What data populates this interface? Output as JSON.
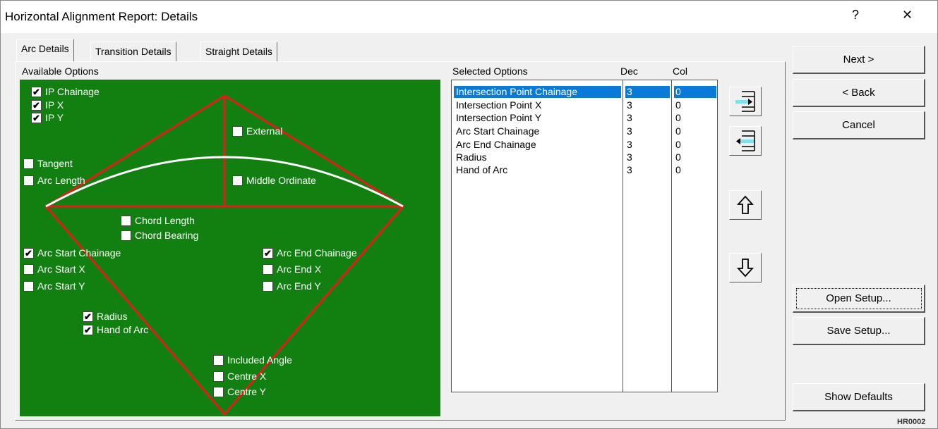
{
  "window": {
    "title": "Horizontal Alignment Report: Details",
    "help": "?",
    "close": "✕"
  },
  "tabs": [
    "Arc Details",
    "Transition Details",
    "Straight Details"
  ],
  "available": {
    "label": "Available Options",
    "options": [
      {
        "label": "IP Chainage",
        "checked": true
      },
      {
        "label": "IP X",
        "checked": true
      },
      {
        "label": "IP Y",
        "checked": true
      },
      {
        "label": "External",
        "checked": false
      },
      {
        "label": "Tangent",
        "checked": false
      },
      {
        "label": "Arc Length",
        "checked": false
      },
      {
        "label": "Middle Ordinate",
        "checked": false
      },
      {
        "label": "Chord Length",
        "checked": false
      },
      {
        "label": "Chord Bearing",
        "checked": false
      },
      {
        "label": "Arc Start Chainage",
        "checked": true
      },
      {
        "label": "Arc Start X",
        "checked": false
      },
      {
        "label": "Arc Start Y",
        "checked": false
      },
      {
        "label": "Arc End Chainage",
        "checked": true
      },
      {
        "label": "Arc End X",
        "checked": false
      },
      {
        "label": "Arc End Y",
        "checked": false
      },
      {
        "label": "Radius",
        "checked": true
      },
      {
        "label": "Hand of Arc",
        "checked": true
      },
      {
        "label": "Included Angle",
        "checked": false
      },
      {
        "label": "Centre X",
        "checked": false
      },
      {
        "label": "Centre Y",
        "checked": false
      }
    ]
  },
  "selected": {
    "label": "Selected Options",
    "dec_header": "Dec",
    "col_header": "Col",
    "rows": [
      {
        "name": "Intersection Point Chainage",
        "dec": "3",
        "col": "0"
      },
      {
        "name": "Intersection Point X",
        "dec": "3",
        "col": "0"
      },
      {
        "name": "Intersection Point Y",
        "dec": "3",
        "col": "0"
      },
      {
        "name": "Arc Start Chainage",
        "dec": "3",
        "col": "0"
      },
      {
        "name": "Arc End Chainage",
        "dec": "3",
        "col": "0"
      },
      {
        "name": "Radius",
        "dec": "3",
        "col": "0"
      },
      {
        "name": "Hand of Arc",
        "dec": "3",
        "col": "0"
      }
    ]
  },
  "buttons": {
    "next": "Next >",
    "back": "< Back",
    "cancel": "Cancel",
    "open_setup": "Open Setup...",
    "save_setup": "Save Setup...",
    "show_defaults": "Show Defaults"
  },
  "code": "HR0002",
  "colors": {
    "diagram_bg": "#118011",
    "lines": "#e21b1b",
    "arc": "#ffffff",
    "selection": "#0a7ad8"
  }
}
